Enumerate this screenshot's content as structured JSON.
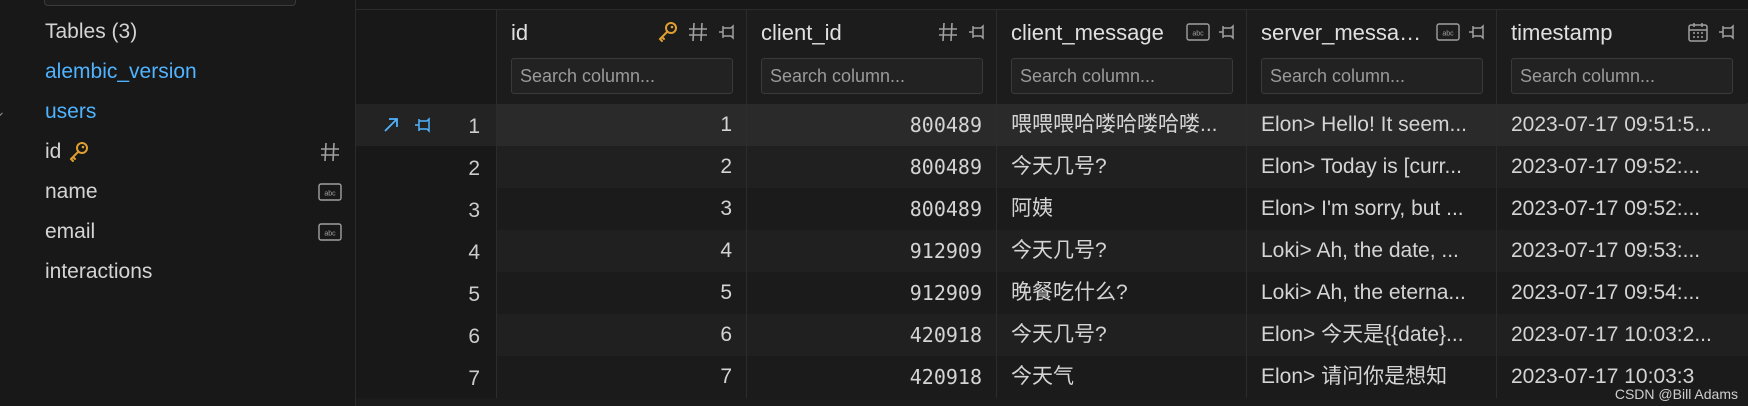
{
  "sidebar": {
    "tables_header": "Tables (3)",
    "items": [
      {
        "label": "alembic_version",
        "link": true,
        "expand": "collapsed"
      },
      {
        "label": "users",
        "link": true,
        "expand": "expanded"
      },
      {
        "label": "id",
        "type_icon": "hash-icon",
        "key": true
      },
      {
        "label": "name",
        "type_icon": "abc-icon"
      },
      {
        "label": "email",
        "type_icon": "abc-icon"
      },
      {
        "label": "interactions",
        "expand": "collapsed"
      }
    ]
  },
  "columns": [
    {
      "name": "id",
      "placeholder": "Search column...",
      "icons": [
        "key-icon",
        "hash-icon",
        "pin-icon"
      ]
    },
    {
      "name": "client_id",
      "placeholder": "Search column...",
      "icons": [
        "hash-icon",
        "pin-icon"
      ]
    },
    {
      "name": "client_message",
      "placeholder": "Search column...",
      "icons": [
        "abc-icon",
        "pin-icon"
      ]
    },
    {
      "name": "server_messa…",
      "placeholder": "Search column...",
      "icons": [
        "abc-icon",
        "pin-icon"
      ]
    },
    {
      "name": "timestamp",
      "placeholder": "Search column...",
      "icons": [
        "calendar-icon",
        "pin-icon"
      ]
    }
  ],
  "rows": [
    {
      "n": "1",
      "id": "1",
      "client_id": "800489",
      "client_message": "喂喂喂哈喽哈喽哈喽...",
      "server_message": "Elon> Hello! It seem...",
      "timestamp": "2023-07-17 09:51:5..."
    },
    {
      "n": "2",
      "id": "2",
      "client_id": "800489",
      "client_message": "今天几号?",
      "server_message": "Elon> Today is [curr...",
      "timestamp": "2023-07-17 09:52:..."
    },
    {
      "n": "3",
      "id": "3",
      "client_id": "800489",
      "client_message": "阿姨",
      "server_message": "Elon> I'm sorry, but ...",
      "timestamp": "2023-07-17 09:52:..."
    },
    {
      "n": "4",
      "id": "4",
      "client_id": "912909",
      "client_message": "今天几号?",
      "server_message": "Loki> Ah, the date, ...",
      "timestamp": "2023-07-17 09:53:..."
    },
    {
      "n": "5",
      "id": "5",
      "client_id": "912909",
      "client_message": "晚餐吃什么?",
      "server_message": "Loki> Ah, the eterna...",
      "timestamp": "2023-07-17 09:54:..."
    },
    {
      "n": "6",
      "id": "6",
      "client_id": "420918",
      "client_message": "今天几号?",
      "server_message": "Elon> 今天是{{date}...",
      "timestamp": "2023-07-17 10:03:2..."
    },
    {
      "n": "7",
      "id": "7",
      "client_id": "420918",
      "client_message": "今天气",
      "server_message": "Elon> 请问你是想知",
      "timestamp": "2023-07-17 10:03:3"
    }
  ],
  "watermark": "CSDN @Bill Adams",
  "colors": {
    "link": "#4fb3ff",
    "key": "#e0a030",
    "accent_icon": "#4fb3ff"
  }
}
